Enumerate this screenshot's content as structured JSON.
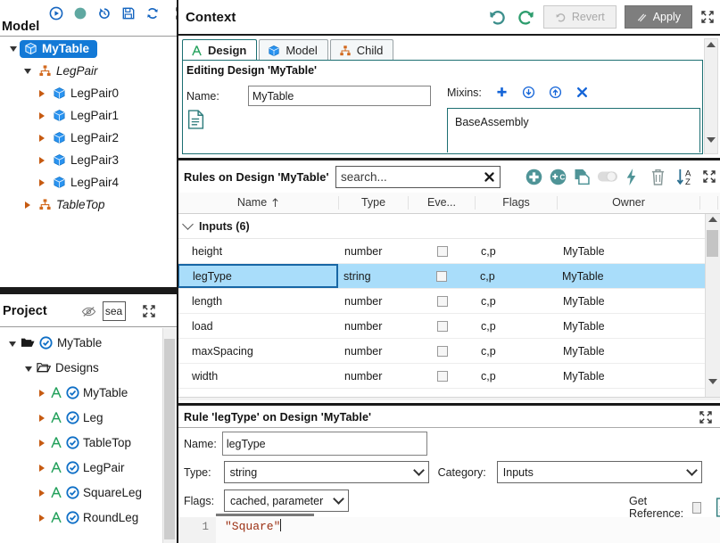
{
  "model": {
    "title": "Model",
    "toolbar": [
      {
        "name": "run-icon",
        "glyph": "play-circle"
      },
      {
        "name": "status-indicator-icon",
        "glyph": "filled-circle"
      },
      {
        "name": "history-icon",
        "glyph": "undo"
      },
      {
        "name": "save-icon",
        "glyph": "floppy"
      },
      {
        "name": "refresh-icon",
        "glyph": "refresh"
      },
      {
        "name": "expand-icon",
        "glyph": "expand"
      }
    ],
    "tree": [
      {
        "label": "MyTable",
        "icon": "cube-icon",
        "depth": 0,
        "twisty": "down",
        "selected": true,
        "italic": false
      },
      {
        "label": "LegPair",
        "icon": "hierarchy-icon",
        "depth": 1,
        "twisty": "down",
        "selected": false,
        "italic": true
      },
      {
        "label": "LegPair0",
        "icon": "cube-icon",
        "depth": 2,
        "twisty": "right",
        "selected": false,
        "italic": false
      },
      {
        "label": "LegPair1",
        "icon": "cube-icon",
        "depth": 2,
        "twisty": "right",
        "selected": false,
        "italic": false
      },
      {
        "label": "LegPair2",
        "icon": "cube-icon",
        "depth": 2,
        "twisty": "right",
        "selected": false,
        "italic": false
      },
      {
        "label": "LegPair3",
        "icon": "cube-icon",
        "depth": 2,
        "twisty": "right",
        "selected": false,
        "italic": false
      },
      {
        "label": "LegPair4",
        "icon": "cube-icon",
        "depth": 2,
        "twisty": "right",
        "selected": false,
        "italic": false
      },
      {
        "label": "TableTop",
        "icon": "hierarchy-icon",
        "depth": 1,
        "twisty": "right",
        "selected": false,
        "italic": true
      }
    ]
  },
  "project": {
    "title": "Project",
    "search_value": "sea",
    "search_placeholder": "search...",
    "tree": [
      {
        "label": "MyTable",
        "depth": 0,
        "twisty": "down",
        "icons": [
          "folder-open-icon",
          "check-circle-icon"
        ]
      },
      {
        "label": "Designs",
        "depth": 1,
        "twisty": "down",
        "icons": [
          "folder-icon"
        ]
      },
      {
        "label": "MyTable",
        "depth": 2,
        "twisty": "right",
        "icons": [
          "design-a-icon",
          "check-circle-icon"
        ]
      },
      {
        "label": "Leg",
        "depth": 2,
        "twisty": "right",
        "icons": [
          "design-a-icon",
          "check-circle-icon"
        ]
      },
      {
        "label": "TableTop",
        "depth": 2,
        "twisty": "right",
        "icons": [
          "design-a-icon",
          "check-circle-icon"
        ]
      },
      {
        "label": "LegPair",
        "depth": 2,
        "twisty": "right",
        "icons": [
          "design-a-icon",
          "check-circle-icon"
        ]
      },
      {
        "label": "SquareLeg",
        "depth": 2,
        "twisty": "right",
        "icons": [
          "design-a-icon",
          "check-circle-icon"
        ]
      },
      {
        "label": "RoundLeg",
        "depth": 2,
        "twisty": "right",
        "icons": [
          "design-a-icon",
          "check-circle-icon"
        ]
      }
    ]
  },
  "context": {
    "title": "Context",
    "undo_icon": "undo-icon",
    "redo_icon": "redo-icon",
    "revert_label": "Revert",
    "apply_label": "Apply",
    "expand_icon": "expand-icon",
    "tabs": [
      {
        "label": "Design",
        "icon": "design-a-icon",
        "active": true
      },
      {
        "label": "Model",
        "icon": "cube-icon",
        "active": false
      },
      {
        "label": "Child",
        "icon": "hierarchy-icon",
        "active": false
      }
    ],
    "editing_label": "Editing Design 'MyTable'",
    "name_label": "Name:",
    "name_value": "MyTable",
    "mixins_label": "Mixins:",
    "mixins_items": [
      "BaseAssembly"
    ],
    "mixins_actions": [
      "add-icon",
      "move-down-icon",
      "move-up-icon",
      "remove-icon"
    ],
    "doc_icon": "document-icon"
  },
  "rules": {
    "title": "Rules on Design 'MyTable'",
    "search_placeholder": "search...",
    "search_value": "",
    "clear_icon": "clear-x-icon",
    "toolbar": [
      {
        "name": "add-rule-button",
        "glyph": "plus-circle"
      },
      {
        "name": "add-child-rule-button",
        "glyph": "plus-c-circle"
      },
      {
        "name": "duplicate-rule-button",
        "glyph": "copy"
      },
      {
        "name": "toggle-button",
        "glyph": "toggle-off"
      },
      {
        "name": "evaluate-button",
        "glyph": "lightning"
      },
      {
        "name": "delete-rule-button",
        "glyph": "trash"
      },
      {
        "name": "sort-button",
        "glyph": "sort-az"
      },
      {
        "name": "expand-button",
        "glyph": "expand"
      }
    ],
    "columns": [
      "Name",
      "Type",
      "Eve...",
      "Flags",
      "Owner"
    ],
    "sort_column": "Name",
    "sort_direction": "ascending",
    "groups": [
      {
        "label": "Inputs (6)",
        "expanded": true,
        "rows": [
          {
            "name": "height",
            "type": "number",
            "event": false,
            "flags": "c,p",
            "owner": "MyTable",
            "selected": false
          },
          {
            "name": "legType",
            "type": "string",
            "event": false,
            "flags": "c,p",
            "owner": "MyTable",
            "selected": true
          },
          {
            "name": "length",
            "type": "number",
            "event": false,
            "flags": "c,p",
            "owner": "MyTable",
            "selected": false
          },
          {
            "name": "load",
            "type": "number",
            "event": false,
            "flags": "c,p",
            "owner": "MyTable",
            "selected": false
          },
          {
            "name": "maxSpacing",
            "type": "number",
            "event": false,
            "flags": "c,p",
            "owner": "MyTable",
            "selected": false
          },
          {
            "name": "width",
            "type": "number",
            "event": false,
            "flags": "c,p",
            "owner": "MyTable",
            "selected": false
          }
        ]
      }
    ]
  },
  "detail": {
    "title": "Rule 'legType' on Design 'MyTable'",
    "expand_icon": "expand-icon",
    "name_label": "Name:",
    "name_value": "legType",
    "type_label": "Type:",
    "type_value": "string",
    "category_label": "Category:",
    "category_value": "Inputs",
    "flags_label": "Flags:",
    "flags_value": "cached, parameter",
    "get_reference_label": "Get Reference:",
    "get_reference_checked": false,
    "doc_icon": "document-icon",
    "code_line_number": "1",
    "code_text": "\"Square\""
  },
  "colors": {
    "accent_teal": "#4f9497",
    "accent_blue": "#1379d6",
    "selection_blue": "#a9ddfa",
    "orange": "#d2691e",
    "green": "#21a05a",
    "code_string": "#9b2f12"
  }
}
